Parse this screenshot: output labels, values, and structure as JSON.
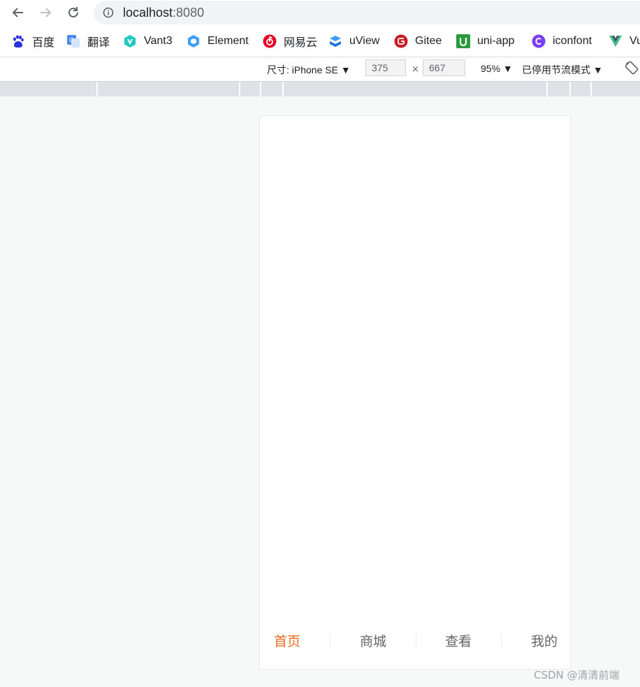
{
  "browser": {
    "url_host": "localhost",
    "url_port": ":8080"
  },
  "bookmarks": [
    {
      "label": "百度",
      "icon": "baidu-icon"
    },
    {
      "label": "翻译",
      "icon": "translate-icon"
    },
    {
      "label": "Vant3",
      "icon": "vant-icon"
    },
    {
      "label": "Element",
      "icon": "element-icon"
    },
    {
      "label": "网易云",
      "icon": "netease-music-icon"
    },
    {
      "label": "uView",
      "icon": "uview-icon"
    },
    {
      "label": "Gitee",
      "icon": "gitee-icon"
    },
    {
      "label": "uni-app",
      "icon": "uniapp-icon"
    },
    {
      "label": "iconfont",
      "icon": "iconfont-icon"
    },
    {
      "label": "Vu",
      "icon": "vue-icon"
    }
  ],
  "devtools": {
    "device_label": "尺寸: iPhone SE ▼",
    "width": "375",
    "times": "×",
    "height": "667",
    "zoom": "95% ▼",
    "throttle": "已停用节流模式 ▼"
  },
  "tabbar": {
    "tabs": [
      {
        "label": "首页",
        "active": true
      },
      {
        "label": "商城",
        "active": false
      },
      {
        "label": "查看",
        "active": false
      },
      {
        "label": "我的",
        "active": false
      }
    ],
    "active_color": "#ee6a1f",
    "inactive_color": "#646566"
  },
  "watermark": "CSDN @清清前端"
}
